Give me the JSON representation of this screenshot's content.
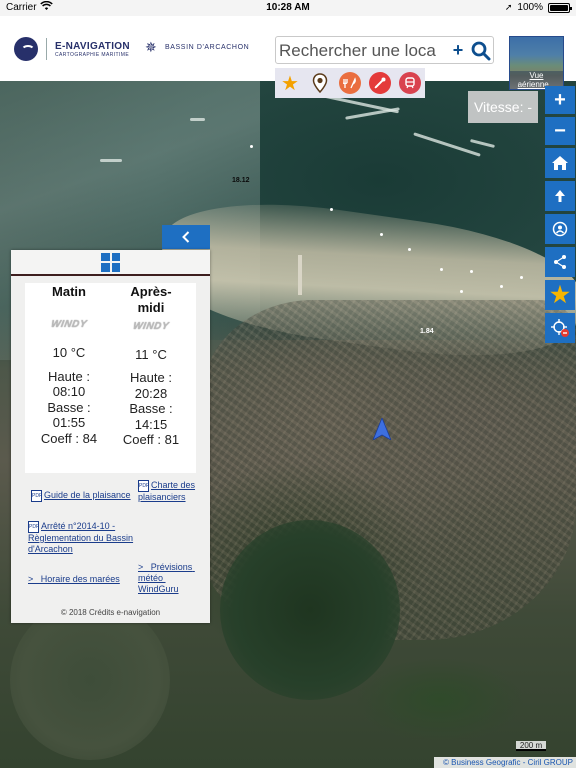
{
  "status_bar": {
    "carrier": "Carrier",
    "time": "10:28 AM",
    "battery_percent": "100%",
    "battery_level": 1.0
  },
  "header": {
    "logo_primary": "E-NAVIGATION",
    "logo_subtitle": "CARTOGRAPHIE MARITIME",
    "logo_secondary": "BASSIN D'ARCACHON",
    "search": {
      "value": "Rechercher une loca",
      "add_symbol": "+"
    },
    "filters": [
      "star-icon",
      "pin-icon",
      "restaurant-icon",
      "shop-icon",
      "train-icon"
    ],
    "aerial_view_label": "Vue aérienne..."
  },
  "speed_label": "Vitesse: -",
  "toolbar": {
    "items": [
      "plus-icon",
      "minus-icon",
      "home-icon",
      "up-arrow-icon",
      "person-pin-icon",
      "share-icon",
      "star-icon",
      "locate-icon"
    ],
    "colors": {
      "button": "#1e6fc2",
      "star": "#f7b500"
    }
  },
  "map_labels": {
    "depth_1": "18.12",
    "depth_2": "1.84"
  },
  "panel": {
    "columns": [
      {
        "title": "Matin",
        "windy": "WINDY",
        "temperature": "10 °C",
        "high": "Haute :\n08:10",
        "low": "Basse :\n01:55",
        "coeff": "Coeff : 84"
      },
      {
        "title": "Après-midi",
        "windy": "WINDY",
        "temperature": "11 °C",
        "high": "Haute :\n20:28",
        "low": "Basse :\n14:15",
        "coeff": "Coeff : 81"
      }
    ],
    "links": {
      "guide": "Guide de la plaisance",
      "charte": "Charte des plaisanciers",
      "arrete": "Arrêté n°2014-10 - Règlementation du Bassin d'Arcachon",
      "marees": ">   Horaire des marées",
      "meteo": ">   Prévisions météo WindGuru",
      "pdf_label": "PDF"
    },
    "credits": "© 2018 Crédits e-navigation"
  },
  "scale_label": "200 m",
  "attribution": "© Business Geografic - Ciril GROUP"
}
